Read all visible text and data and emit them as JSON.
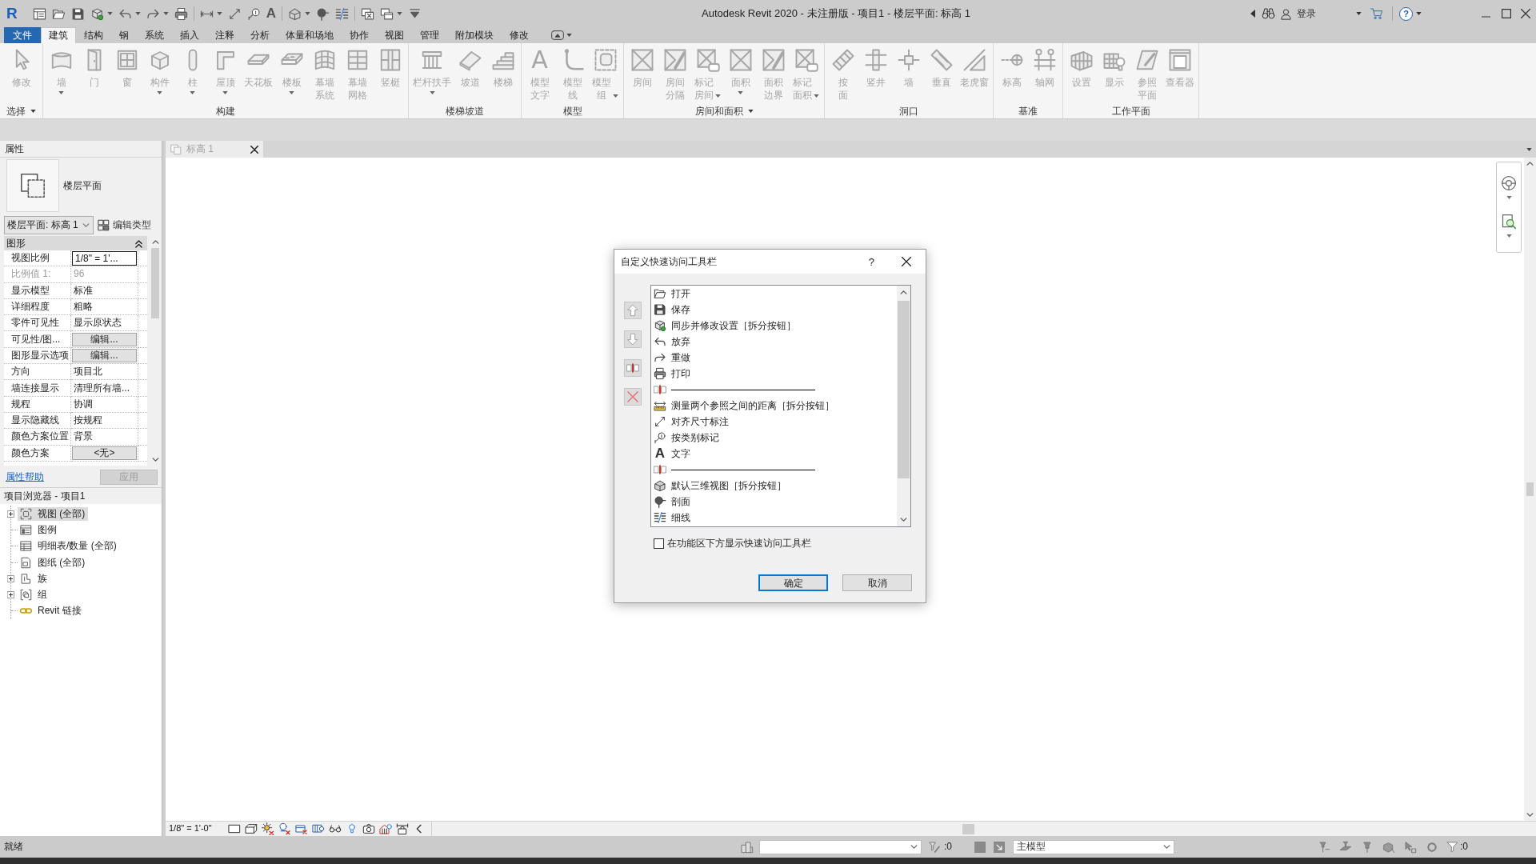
{
  "window": {
    "title": "Autodesk Revit 2020 - 未注册版 - 项目1 - 楼层平面: 标高 1"
  },
  "title_bar": {
    "logo": "R",
    "text_glyph": "A",
    "sign_in": "登录",
    "help": "?"
  },
  "ribbon_tabs": [
    {
      "label": "文件",
      "kind": "file",
      "selected": false
    },
    {
      "label": "建筑",
      "kind": "tab",
      "selected": true
    },
    {
      "label": "结构",
      "kind": "tab",
      "selected": false
    },
    {
      "label": "钢",
      "kind": "tab",
      "selected": false
    },
    {
      "label": "系统",
      "kind": "tab",
      "selected": false
    },
    {
      "label": "插入",
      "kind": "tab",
      "selected": false
    },
    {
      "label": "注释",
      "kind": "tab",
      "selected": false
    },
    {
      "label": "分析",
      "kind": "tab",
      "selected": false
    },
    {
      "label": "体量和场地",
      "kind": "tab",
      "selected": false
    },
    {
      "label": "协作",
      "kind": "tab",
      "selected": false
    },
    {
      "label": "视图",
      "kind": "tab",
      "selected": false
    },
    {
      "label": "管理",
      "kind": "tab",
      "selected": false
    },
    {
      "label": "附加模块",
      "kind": "tab",
      "selected": false
    },
    {
      "label": "修改",
      "kind": "tab",
      "selected": false
    }
  ],
  "ribbon_panels": [
    {
      "label": "选择",
      "has_menu": true,
      "tools": [
        {
          "lines": [
            "修改"
          ],
          "dropdown": false,
          "disabled": true
        }
      ]
    },
    {
      "label": "构建",
      "has_menu": false,
      "tools": [
        {
          "lines": [
            "墙"
          ],
          "dropdown": true,
          "disabled": true
        },
        {
          "lines": [
            "门"
          ],
          "dropdown": false,
          "disabled": true
        },
        {
          "lines": [
            "窗"
          ],
          "dropdown": false,
          "disabled": true
        },
        {
          "lines": [
            "构件"
          ],
          "dropdown": true,
          "disabled": true
        },
        {
          "lines": [
            "柱"
          ],
          "dropdown": true,
          "disabled": true
        },
        {
          "lines": [
            "屋顶"
          ],
          "dropdown": true,
          "disabled": true
        },
        {
          "lines": [
            "天花板"
          ],
          "dropdown": false,
          "disabled": true
        },
        {
          "lines": [
            "楼板"
          ],
          "dropdown": true,
          "disabled": true
        },
        {
          "lines": [
            "幕墙",
            "系统"
          ],
          "dropdown": false,
          "disabled": true
        },
        {
          "lines": [
            "幕墙",
            "网格"
          ],
          "dropdown": false,
          "disabled": true
        },
        {
          "lines": [
            "竖梃"
          ],
          "dropdown": false,
          "disabled": true
        }
      ]
    },
    {
      "label": "楼梯坡道",
      "has_menu": false,
      "tools": [
        {
          "lines": [
            "栏杆扶手"
          ],
          "dropdown": true,
          "disabled": true
        },
        {
          "lines": [
            "坡道"
          ],
          "dropdown": false,
          "disabled": true
        },
        {
          "lines": [
            "楼梯"
          ],
          "dropdown": false,
          "disabled": true
        }
      ]
    },
    {
      "label": "模型",
      "has_menu": false,
      "tools": [
        {
          "lines": [
            "模型",
            "文字"
          ],
          "glyph": "A",
          "dropdown": false,
          "disabled": true
        },
        {
          "lines": [
            "模型",
            "线"
          ],
          "dropdown": false,
          "disabled": true
        },
        {
          "lines": [
            "模型",
            "组"
          ],
          "dropdown": true,
          "disabled": true
        }
      ]
    },
    {
      "label": "房间和面积",
      "has_menu": true,
      "tools": [
        {
          "lines": [
            "房间"
          ],
          "dropdown": false,
          "disabled": true
        },
        {
          "lines": [
            "房间",
            "分隔"
          ],
          "dropdown": false,
          "disabled": true
        },
        {
          "lines": [
            "标记",
            "房间"
          ],
          "dropdown": true,
          "disabled": true
        },
        {
          "lines": [
            "面积"
          ],
          "dropdown": true,
          "disabled": true
        },
        {
          "lines": [
            "面积",
            "边界"
          ],
          "dropdown": false,
          "disabled": true
        },
        {
          "lines": [
            "标记",
            "面积"
          ],
          "dropdown": true,
          "disabled": true
        }
      ]
    },
    {
      "label": "洞口",
      "has_menu": false,
      "tools": [
        {
          "lines": [
            "按",
            "面"
          ],
          "dropdown": false,
          "disabled": true
        },
        {
          "lines": [
            "竖井"
          ],
          "dropdown": false,
          "disabled": true
        },
        {
          "lines": [
            "墙"
          ],
          "dropdown": false,
          "disabled": true
        },
        {
          "lines": [
            "垂直"
          ],
          "dropdown": false,
          "disabled": true
        },
        {
          "lines": [
            "老虎窗"
          ],
          "dropdown": false,
          "disabled": true
        }
      ]
    },
    {
      "label": "基准",
      "has_menu": false,
      "tools": [
        {
          "lines": [
            "标高"
          ],
          "dropdown": false,
          "disabled": true
        },
        {
          "lines": [
            "轴网"
          ],
          "dropdown": false,
          "disabled": true
        }
      ]
    },
    {
      "label": "工作平面",
      "has_menu": false,
      "tools": [
        {
          "lines": [
            "设置"
          ],
          "dropdown": false,
          "disabled": true
        },
        {
          "lines": [
            "显示"
          ],
          "dropdown": false,
          "disabled": true
        },
        {
          "lines": [
            "参照",
            "平面"
          ],
          "dropdown": false,
          "disabled": true
        },
        {
          "lines": [
            "查看器"
          ],
          "dropdown": false,
          "disabled": true
        }
      ]
    }
  ],
  "properties": {
    "title": "属性",
    "type_name": "楼层平面",
    "type_selector": "楼层平面: 标高 1",
    "edit_type": "编辑类型",
    "group": "图形",
    "rows": [
      {
        "label": "视图比例",
        "value": "1/8\" = 1'...",
        "kind": "input",
        "disabled": false
      },
      {
        "label": "比例值 1:",
        "value": "96",
        "kind": "text",
        "disabled": true
      },
      {
        "label": "显示模型",
        "value": "标准",
        "kind": "text",
        "disabled": false
      },
      {
        "label": "详细程度",
        "value": "粗略",
        "kind": "text",
        "disabled": false
      },
      {
        "label": "零件可见性",
        "value": "显示原状态",
        "kind": "text",
        "disabled": false
      },
      {
        "label": "可见性/图...",
        "value": "编辑...",
        "kind": "button",
        "disabled": false
      },
      {
        "label": "图形显示选项",
        "value": "编辑...",
        "kind": "button",
        "disabled": false
      },
      {
        "label": "方向",
        "value": "项目北",
        "kind": "text",
        "disabled": false
      },
      {
        "label": "墙连接显示",
        "value": "清理所有墙...",
        "kind": "text",
        "disabled": false
      },
      {
        "label": "规程",
        "value": "协调",
        "kind": "text",
        "disabled": false
      },
      {
        "label": "显示隐藏线",
        "value": "按规程",
        "kind": "text",
        "disabled": false
      },
      {
        "label": "颜色方案位置",
        "value": "背景",
        "kind": "text",
        "disabled": false
      },
      {
        "label": "颜色方案",
        "value": "<无>",
        "kind": "button",
        "disabled": false
      }
    ],
    "help_link": "属性帮助",
    "apply_button": {
      "label": "应用",
      "disabled": true
    }
  },
  "project_browser": {
    "title": "项目浏览器 - 项目1",
    "items": [
      {
        "label": "视图 (全部)",
        "expanded": false,
        "selected": true
      },
      {
        "label": "图例",
        "selected": false
      },
      {
        "label": "明细表/数量 (全部)",
        "selected": false
      },
      {
        "label": "图纸 (全部)",
        "selected": false
      },
      {
        "label": "族",
        "expanded": false,
        "selected": false
      },
      {
        "label": "组",
        "expanded": false,
        "selected": false
      },
      {
        "label": "Revit 链接",
        "selected": false
      }
    ]
  },
  "view_tab": {
    "label": "标高 1"
  },
  "view_control_bar": {
    "scale": "1/8\" = 1'-0\""
  },
  "dialog": {
    "title": "自定义快速访问工具栏",
    "help_button": "?",
    "commands": [
      {
        "kind": "command",
        "label": "打开"
      },
      {
        "kind": "command",
        "label": "保存"
      },
      {
        "kind": "command",
        "label": "同步并修改设置［拆分按钮］"
      },
      {
        "kind": "command",
        "label": "放弃"
      },
      {
        "kind": "command",
        "label": "重做"
      },
      {
        "kind": "command",
        "label": "打印"
      },
      {
        "kind": "separator"
      },
      {
        "kind": "command",
        "label": "测量两个参照之间的距离［拆分按钮］"
      },
      {
        "kind": "command",
        "label": "对齐尺寸标注"
      },
      {
        "kind": "command",
        "label": "按类别标记"
      },
      {
        "kind": "command",
        "label": "文字",
        "glyph": "A"
      },
      {
        "kind": "separator"
      },
      {
        "kind": "command",
        "label": "默认三维视图［拆分按钮］"
      },
      {
        "kind": "command",
        "label": "剖面"
      },
      {
        "kind": "command",
        "label": "细线"
      }
    ],
    "checkbox": {
      "label": "在功能区下方显示快速访问工具栏",
      "checked": false
    },
    "buttons": [
      {
        "label": "确定",
        "default": true
      },
      {
        "label": "取消",
        "default": false
      }
    ]
  },
  "status_bar": {
    "text": "就绪",
    "editable_count": ":0",
    "design_option": "主模型",
    "filter_count": ":0"
  }
}
